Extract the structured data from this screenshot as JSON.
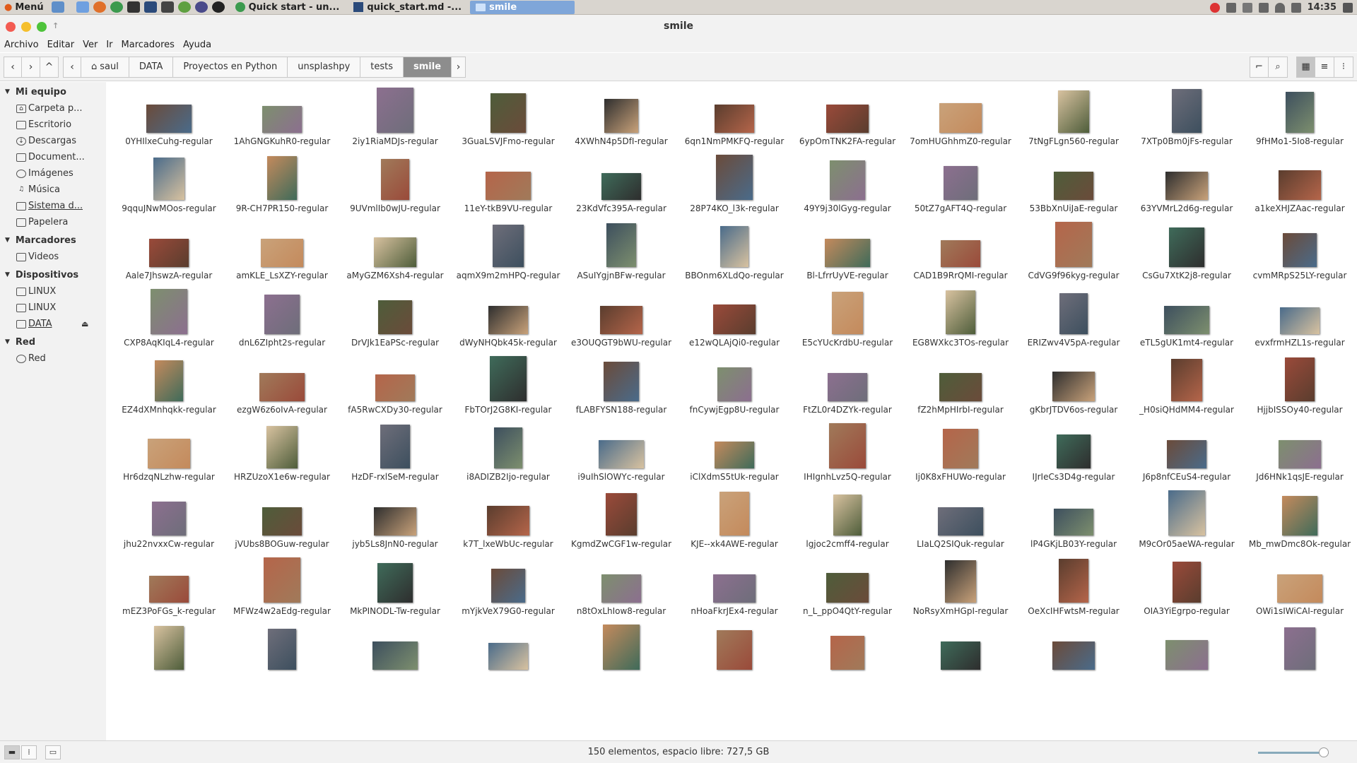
{
  "topbar": {
    "menu_label": "Menú",
    "tasks": [
      {
        "label": "Quick start - un..."
      },
      {
        "label": "quick_start.md -..."
      },
      {
        "label": "smile"
      }
    ],
    "clock": "14:35"
  },
  "window": {
    "title": "smile"
  },
  "menubar": {
    "items": [
      "Archivo",
      "Editar",
      "Ver",
      "Ir",
      "Marcadores",
      "Ayuda"
    ]
  },
  "breadcrumb": {
    "items": [
      "saul",
      "DATA",
      "Proyectos en Python",
      "unsplashpy",
      "tests",
      "smile"
    ]
  },
  "sidebar": {
    "sections": [
      {
        "title": "Mi equipo",
        "items": [
          "Carpeta p...",
          "Escritorio",
          "Descargas",
          "Document...",
          "Imágenes",
          "Música",
          "Sistema d...",
          "Papelera"
        ]
      },
      {
        "title": "Marcadores",
        "items": [
          "Videos"
        ]
      },
      {
        "title": "Dispositivos",
        "items": [
          "LINUX",
          "LINUX",
          "DATA"
        ]
      },
      {
        "title": "Red",
        "items": [
          "Red"
        ]
      }
    ]
  },
  "files": [
    "0YHIlxeCuhg-regular",
    "1AhGNGKuhR0-regular",
    "2iy1RiaMDJs-regular",
    "3GuaLSVJFmo-regular",
    "4XWhN4p5DfI-regular",
    "6qn1NmPMKFQ-regular",
    "6ypOmTNK2FA-regular",
    "7omHUGhhmZ0-regular",
    "7tNgFLgn560-regular",
    "7XTp0Bm0jFs-regular",
    "9fHMo1-5Io8-regular",
    "9qquJNwMOos-regular",
    "9R-CH7PR150-regular",
    "9UVmlIb0wJU-regular",
    "11eY-tkB9VU-regular",
    "23KdVfc395A-regular",
    "28P74KO_l3k-regular",
    "49Y9j30lGyg-regular",
    "50tZ7gAFT4Q-regular",
    "53BbXnUiJaE-regular",
    "63YVMrL2d6g-regular",
    "a1keXHJZAac-regular",
    "Aale7JhswzA-regular",
    "amKLE_LsXZY-regular",
    "aMyGZM6Xsh4-regular",
    "aqmX9m2mHPQ-regular",
    "ASuIYgjnBFw-regular",
    "BBOnm6XLdQo-regular",
    "Bl-LfrrUyVE-regular",
    "CAD1B9RrQMI-regular",
    "CdVG9f96kyg-regular",
    "CsGu7XtK2j8-regular",
    "cvmMRpS25LY-regular",
    "CXP8AqKIqL4-regular",
    "dnL6ZIpht2s-regular",
    "DrVJk1EaPSc-regular",
    "dWyNHQbk45k-regular",
    "e3OUQGT9bWU-regular",
    "e12wQLAjQi0-regular",
    "E5cYUcKrdbU-regular",
    "EG8WXkc3TOs-regular",
    "ERIZwv4V5pA-regular",
    "eTL5gUK1mt4-regular",
    "evxfrmHZL1s-regular",
    "EZ4dXMnhqkk-regular",
    "ezgW6z6oIvA-regular",
    "fA5RwCXDy30-regular",
    "FbTOrJ2G8KI-regular",
    "fLABFYSN188-regular",
    "fnCywjEgp8U-regular",
    "FtZL0r4DZYk-regular",
    "fZ2hMpHIrbI-regular",
    "gKbrJTDV6os-regular",
    "_H0siQHdMM4-regular",
    "HjjbISSOy40-regular",
    "Hr6dzqNLzhw-regular",
    "HRZUzoX1e6w-regular",
    "HzDF-rxlSeM-regular",
    "i8ADIZB2Ijo-regular",
    "i9uIhSlOWYc-regular",
    "iClXdmS5tUk-regular",
    "IHIgnhLvz5Q-regular",
    "Ij0K8xFHUWo-regular",
    "IJrIeCs3D4g-regular",
    "J6p8nfCEuS4-regular",
    "Jd6HNk1qsJE-regular",
    "jhu22nvxxCw-regular",
    "jVUbs8BOGuw-regular",
    "jyb5Ls8JnN0-regular",
    "k7T_lxeWbUc-regular",
    "KgmdZwCGF1w-regular",
    "KJE--xk4AWE-regular",
    "lgjoc2cmff4-regular",
    "LIaLQ2SIQuk-regular",
    "lP4GKjLB03Y-regular",
    "M9cOr05aeWA-regular",
    "Mb_mwDmc8Ok-regular",
    "mEZ3PoFGs_k-regular",
    "MFWz4w2aEdg-regular",
    "MkPINODL-Tw-regular",
    "mYjkVeX79G0-regular",
    "n8tOxLhIow8-regular",
    "nHoaFkrJEx4-regular",
    "n_L_ppO4QtY-regular",
    "NoRsyXmHGpI-regular",
    "OeXcIHFwtsM-regular",
    "OIA3YiEgrpo-regular",
    "OWi1sIWiCAI-regular",
    "",
    "",
    "",
    "",
    "",
    "",
    "",
    "",
    "",
    "",
    ""
  ],
  "status": {
    "text": "150 elementos, espacio libre: 727,5 GB"
  },
  "colors": {
    "accent": "#7fa6d9",
    "crumb_active": "#8d8d8d"
  }
}
